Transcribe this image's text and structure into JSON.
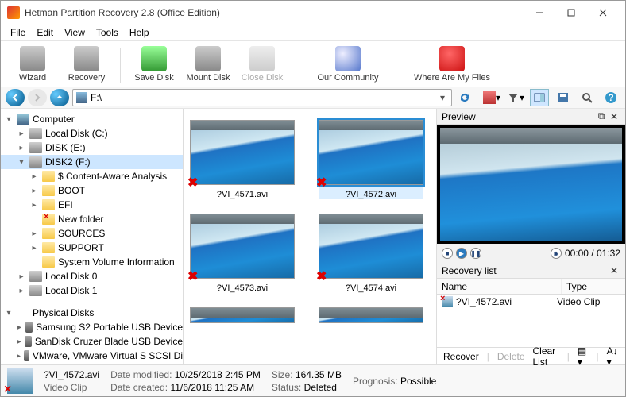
{
  "window": {
    "title": "Hetman Partition Recovery 2.8 (Office Edition)"
  },
  "menu": {
    "file": "File",
    "edit": "Edit",
    "view": "View",
    "tools": "Tools",
    "help": "Help"
  },
  "toolbar": {
    "wizard": "Wizard",
    "recovery": "Recovery",
    "save_disk": "Save Disk",
    "mount_disk": "Mount Disk",
    "close_disk": "Close Disk",
    "community": "Our Community",
    "where": "Where Are My Files"
  },
  "address": {
    "path": "F:\\"
  },
  "tree": {
    "computer": "Computer",
    "local_c": "Local Disk (C:)",
    "disk_e": "DISK (E:)",
    "disk2_f": "DISK2 (F:)",
    "content_aware": "$ Content-Aware Analysis",
    "boot": "BOOT",
    "efi": "EFI",
    "new_folder": "New folder",
    "sources": "SOURCES",
    "support": "SUPPORT",
    "svi": "System Volume Information",
    "local0": "Local Disk 0",
    "local1": "Local Disk 1",
    "physical": "Physical Disks",
    "samsung": "Samsung S2 Portable USB Device",
    "sandisk": "SanDisk Cruzer Blade USB Device",
    "vmware": "VMware, VMware Virtual S SCSI Di"
  },
  "files": [
    {
      "name": "?VI_4571.avi"
    },
    {
      "name": "?VI_4572.avi",
      "selected": true
    },
    {
      "name": "?VI_4573.avi"
    },
    {
      "name": "?VI_4574.avi"
    }
  ],
  "preview": {
    "title": "Preview",
    "time": "00:00 / 01:32"
  },
  "recovery_list": {
    "title": "Recovery list",
    "col_name": "Name",
    "col_type": "Type",
    "rows": [
      {
        "name": "?VI_4572.avi",
        "type": "Video Clip"
      }
    ],
    "recover": "Recover",
    "delete": "Delete",
    "clear": "Clear List"
  },
  "status": {
    "filename": "?VI_4572.avi",
    "filetype": "Video Clip",
    "date_modified_lbl": "Date modified:",
    "date_modified": "10/25/2018 2:45 PM",
    "date_created_lbl": "Date created:",
    "date_created": "11/6/2018 11:25 AM",
    "size_lbl": "Size:",
    "size": "164.35 MB",
    "status_lbl": "Status:",
    "status_val": "Deleted",
    "prognosis_lbl": "Prognosis:",
    "prognosis": "Possible"
  }
}
